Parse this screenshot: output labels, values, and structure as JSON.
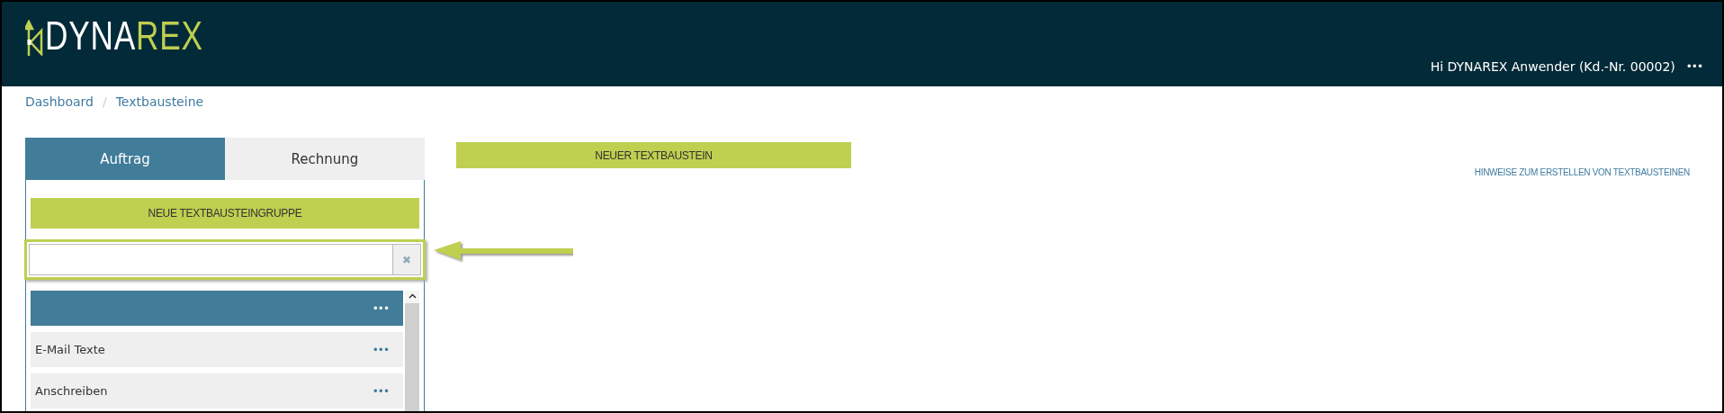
{
  "header": {
    "logo": {
      "primary": "DYNA",
      "accent": "REX"
    },
    "user_greeting": "Hi DYNAREX Anwender (Kd.-Nr. 00002)",
    "menu_label": "•••"
  },
  "breadcrumb": [
    "Dashboard",
    "Textbausteine"
  ],
  "breadcrumb_separator": "/",
  "tabs": [
    {
      "label": "Auftrag",
      "selected": true
    },
    {
      "label": "Rechnung",
      "selected": false
    }
  ],
  "new_group_button": "NEUE TEXTBAUSTEINGRUPPE",
  "search": {
    "clear_label": "✖"
  },
  "groups": [
    {
      "selected": true,
      "menu_label": "•••"
    },
    {
      "label": "E-Mail Texte",
      "selected": false,
      "menu_label": "•••"
    },
    {
      "label": "Anschreiben",
      "selected": false,
      "menu_label": "•••"
    }
  ],
  "new_block_button": "NEUER TEXTBAUSTEIN",
  "help_link": "HINWEISE ZUM ERSTELLEN VON TEXTBAUSTEINEN"
}
